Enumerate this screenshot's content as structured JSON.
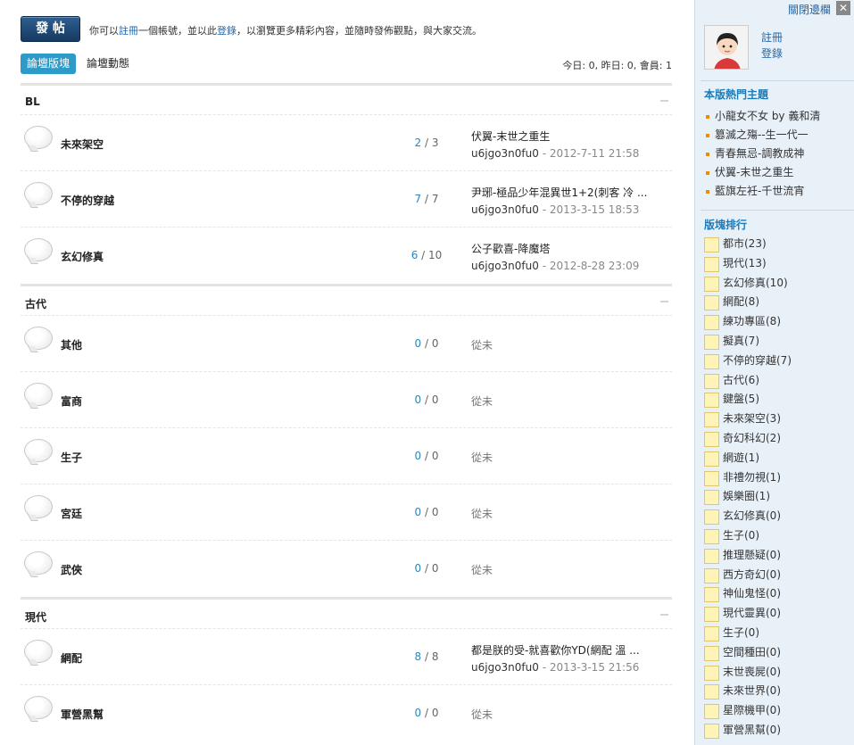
{
  "header": {
    "post_label": "發 帖",
    "notice_prefix": "你可以",
    "notice_register": "註冊",
    "notice_mid": "一個帳號，並以此",
    "notice_login": "登錄",
    "notice_suffix": "，以瀏覽更多精彩內容，並隨時發佈觀點，與大家交流。"
  },
  "tabs": {
    "forum": "論壇版塊",
    "activity": "論壇動態"
  },
  "stats": "今日: 0, 昨日: 0, 會員: 1",
  "categories": [
    {
      "name": "BL",
      "forums": [
        {
          "name": "未來架空",
          "threads": "2",
          "posts": "3",
          "last_title": "伏翼-末世之重生",
          "last_user": "u6jgo3n0fu0",
          "last_time": "2012-7-11 21:58"
        },
        {
          "name": "不停的穿越",
          "threads": "7",
          "posts": "7",
          "last_title": "尹琊-極品少年混異世1+2(刺客 冷 ...",
          "last_user": "u6jgo3n0fu0",
          "last_time": "2013-3-15 18:53"
        },
        {
          "name": "玄幻修真",
          "threads": "6",
          "posts": "10",
          "last_title": "公子歡喜-降魔塔",
          "last_user": "u6jgo3n0fu0",
          "last_time": "2012-8-28 23:09"
        }
      ]
    },
    {
      "name": "古代",
      "forums": [
        {
          "name": "其他",
          "threads": "0",
          "posts": "0",
          "never": "從未"
        },
        {
          "name": "富商",
          "threads": "0",
          "posts": "0",
          "never": "從未"
        },
        {
          "name": "生子",
          "threads": "0",
          "posts": "0",
          "never": "從未"
        },
        {
          "name": "宮廷",
          "threads": "0",
          "posts": "0",
          "never": "從未"
        },
        {
          "name": "武俠",
          "threads": "0",
          "posts": "0",
          "never": "從未"
        }
      ]
    },
    {
      "name": "現代",
      "forums": [
        {
          "name": "網配",
          "threads": "8",
          "posts": "8",
          "last_title": "都是朕的受-就喜歡你YD(網配 溫 ...",
          "last_user": "u6jgo3n0fu0",
          "last_time": "2013-3-15 21:56"
        },
        {
          "name": "軍營黑幫",
          "threads": "0",
          "posts": "0",
          "never": "從未"
        }
      ]
    }
  ],
  "sidebar": {
    "close_label": "關閉邊欄",
    "close_x": "✕",
    "register": "註冊",
    "login": "登錄",
    "hot_title": "本版熱門主題",
    "hot_topics": [
      "小龍女不女 by 義和清",
      "篡滅之殤--生一代一",
      "青春無忌-調教成神",
      "伏翼-末世之重生",
      "藍旗左衽-千世流宵"
    ],
    "rank_title": "版塊排行",
    "rank": [
      "都市(23)",
      "現代(13)",
      "玄幻修真(10)",
      "網配(8)",
      "練功專區(8)",
      "擬真(7)",
      "不停的穿越(7)",
      "古代(6)",
      "鍵盤(5)",
      "未來架空(3)",
      "奇幻科幻(2)",
      "網遊(1)",
      "非禮勿視(1)",
      "娛樂圈(1)",
      "玄幻修真(0)",
      "生子(0)",
      "推理懸疑(0)",
      "西方奇幻(0)",
      "神仙鬼怪(0)",
      "現代靈異(0)",
      "生子(0)",
      "空間種田(0)",
      "末世喪屍(0)",
      "未來世界(0)",
      "星際機甲(0)",
      "軍營黑幫(0)"
    ]
  }
}
